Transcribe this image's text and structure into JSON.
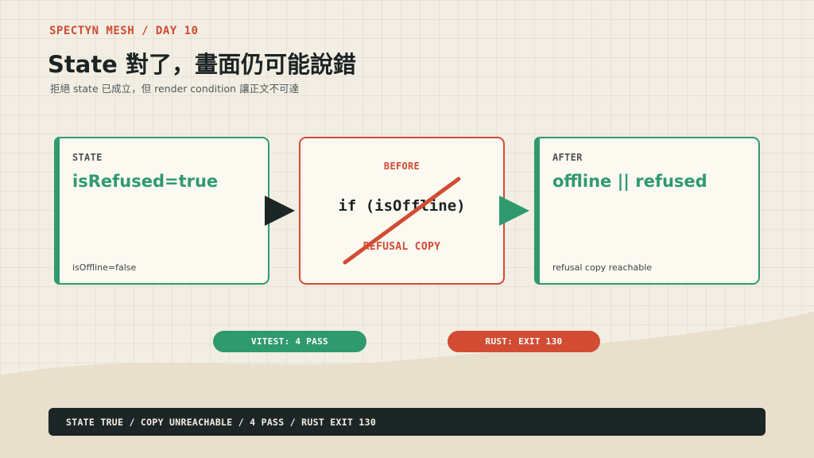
{
  "header": {
    "eyebrow": "SPECTYN MESH / DAY 10",
    "title": "State 對了，畫面仍可能說錯",
    "subtitle": "拒絕 state 已成立，但 render condition 讓正文不可達"
  },
  "cards": {
    "state": {
      "label": "STATE",
      "value": "isRefused=true",
      "foot": "isOffline=false"
    },
    "before": {
      "label": "BEFORE",
      "code": "if (isOffline)",
      "copy": "REFUSAL COPY",
      "struck": true
    },
    "after": {
      "label": "AFTER",
      "value": "offline || refused",
      "foot": "refusal copy reachable"
    }
  },
  "badges": {
    "vitest": "VITEST: 4 PASS",
    "rust": "RUST: EXIT 130"
  },
  "footer": {
    "summary": "STATE TRUE / COPY UNREACHABLE / 4 PASS / RUST EXIT 130"
  },
  "colors": {
    "accent_red": "#d24b33",
    "accent_green": "#2f9a6e",
    "dark": "#1d2626",
    "background": "#f3eee3"
  }
}
